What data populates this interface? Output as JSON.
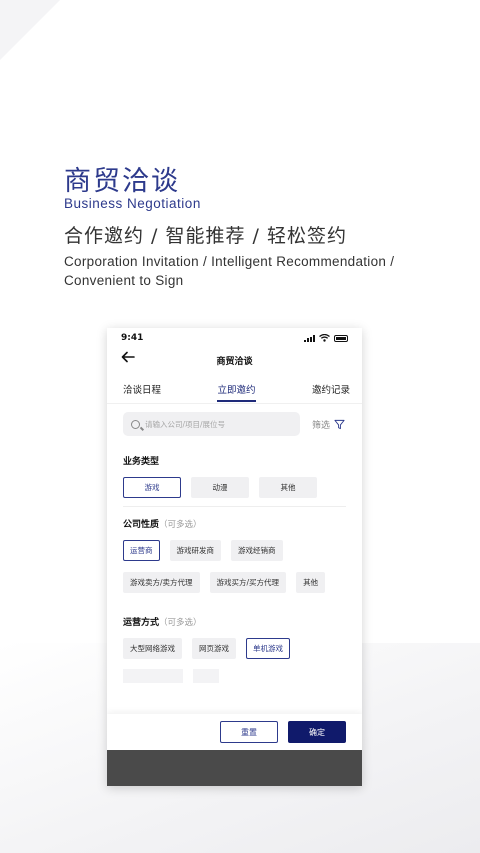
{
  "hero": {
    "title_cn": "商贸洽谈",
    "title_en": "Business Negotiation",
    "slogan_cn": "合作邀约 / 智能推荐 /  轻松签约",
    "slogan_en_line1": "Corporation Invitation / Intelligent Recommendation /",
    "slogan_en_line2": "Convenient to Sign"
  },
  "status_bar": {
    "time": "9:41"
  },
  "nav": {
    "back_icon": "arrow-left-icon",
    "title": "商贸洽谈"
  },
  "tabs": [
    {
      "label": "洽谈日程",
      "active": false
    },
    {
      "label": "立即邀约",
      "active": true
    },
    {
      "label": "邀约记录",
      "active": false
    }
  ],
  "search": {
    "placeholder": "请输入公司/项目/展位号",
    "filter_label": "筛选"
  },
  "sections": {
    "business_type": {
      "title": "业务类型",
      "options": [
        {
          "label": "游戏",
          "selected": true
        },
        {
          "label": "动漫",
          "selected": false
        },
        {
          "label": "其他",
          "selected": false
        }
      ]
    },
    "company_nature": {
      "title": "公司性质",
      "hint": "（可多选）",
      "options": [
        {
          "label": "运营商",
          "selected": true
        },
        {
          "label": "游戏研发商",
          "selected": false
        },
        {
          "label": "游戏经销商",
          "selected": false
        },
        {
          "label": "游戏卖方/卖方代理",
          "selected": false
        },
        {
          "label": "游戏买方/买方代理",
          "selected": false
        },
        {
          "label": "其他",
          "selected": false
        }
      ]
    },
    "operation_mode": {
      "title": "运营方式",
      "hint": "（可多选）",
      "options": [
        {
          "label": "大型网络游戏",
          "selected": false
        },
        {
          "label": "网页游戏",
          "selected": false
        },
        {
          "label": "单机游戏",
          "selected": true
        }
      ]
    }
  },
  "footer": {
    "reset_label": "重置",
    "confirm_label": "确定"
  },
  "colors": {
    "accent": "#2d3a8c",
    "confirm": "#101a6b",
    "chip_bg": "#f0f0f2"
  }
}
